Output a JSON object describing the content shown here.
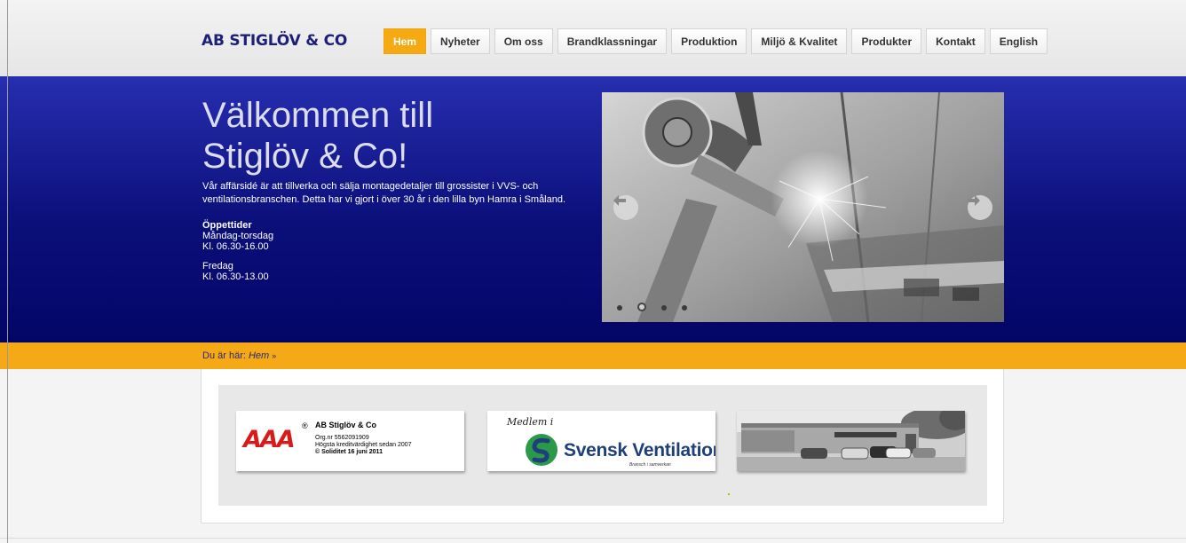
{
  "site": {
    "logo_text": "AB STIGLÖV & CO"
  },
  "nav": {
    "items": [
      {
        "label": "Hem",
        "active": true
      },
      {
        "label": "Nyheter",
        "active": false
      },
      {
        "label": "Om oss",
        "active": false
      },
      {
        "label": "Brandklassningar",
        "active": false
      },
      {
        "label": "Produktion",
        "active": false
      },
      {
        "label": "Miljö & Kvalitet",
        "active": false
      },
      {
        "label": "Produkter",
        "active": false
      },
      {
        "label": "Kontakt",
        "active": false
      },
      {
        "label": "English",
        "active": false
      }
    ]
  },
  "hero": {
    "title_line1": "Välkommen till",
    "title_line2": "Stiglöv & Co!",
    "description": "Vår affärsidé är att tillverka och sälja montagedetaljer till grossister i VVS- och ventilationsbranschen. Detta har vi gjort i över 30 år i den lilla byn Hamra i Småland.",
    "hours_heading": "Öppettider",
    "weekday_label": "Måndag-torsdag",
    "weekday_hours": "Kl. 06.30-16.00",
    "friday_label": "Fredag",
    "friday_hours": "Kl. 06.30-13.00"
  },
  "slider": {
    "image_icon": "welding-robot-photo",
    "prev_icon": "arrow-left-icon",
    "next_icon": "arrow-right-icon",
    "slide_count": 4,
    "active_index": 1
  },
  "breadcrumb": {
    "prefix": "Du är här:",
    "current": "Hem",
    "separator": "»"
  },
  "partners": {
    "aaa": {
      "logo_text": "AAA",
      "reg_mark": "®",
      "name": "AB Stiglöv & Co",
      "line1": "Org.nr 5562091909",
      "line2": "Högsta kreditvärdighet sedan 2007",
      "line3": "© Soliditet 16 juni 2011"
    },
    "svensk_ventilation": {
      "medlem": "Medlem i",
      "name": "Svensk Ventilation",
      "tagline": "Bransch i samverkan"
    },
    "building": {
      "image_icon": "factory-building-photo"
    }
  },
  "colors": {
    "accent": "#f5a913",
    "hero_top": "#272eb0",
    "hero_bottom": "#030566",
    "logo_blue": "#1d1f7a",
    "aaa_red": "#d91a1a"
  }
}
